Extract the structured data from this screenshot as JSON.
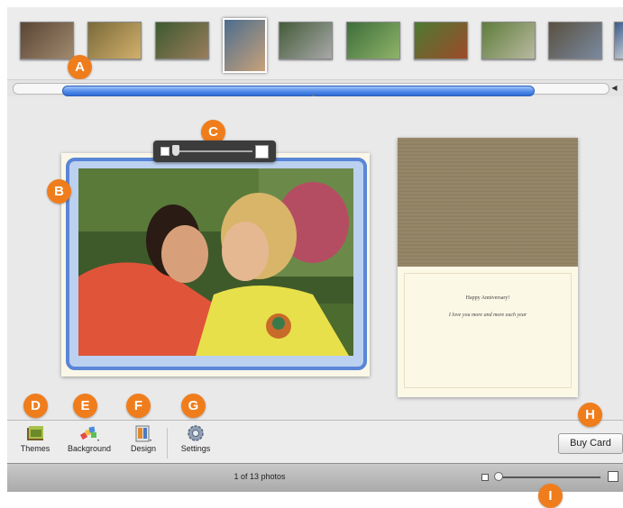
{
  "callouts": {
    "a": "A",
    "b": "B",
    "c": "C",
    "d": "D",
    "e": "E",
    "f": "F",
    "g": "G",
    "h": "H",
    "i": "I"
  },
  "photo_browser": {
    "thumbnails": [
      {
        "colors": [
          "#5a4535",
          "#a0896e"
        ]
      },
      {
        "colors": [
          "#7a6a3a",
          "#d2b06b"
        ]
      },
      {
        "colors": [
          "#3d5a2f",
          "#9a7d5c"
        ]
      },
      {
        "colors": [
          "#4c6d8e",
          "#c8a27a"
        ],
        "selected": true
      },
      {
        "colors": [
          "#445c3a",
          "#a8a8a8"
        ]
      },
      {
        "colors": [
          "#3e6e3a",
          "#8fb36a"
        ]
      },
      {
        "colors": [
          "#4d7a32",
          "#9c4a2a"
        ]
      },
      {
        "colors": [
          "#5f7d3c",
          "#b9b9a0"
        ]
      },
      {
        "colors": [
          "#5a5040",
          "#7a8aa0"
        ]
      },
      {
        "colors": [
          "#3a5a8a",
          "#c0c8d0"
        ]
      }
    ]
  },
  "card": {
    "greeting_title": "Happy Anniversary!",
    "greeting_body": "I love you more and more each year"
  },
  "toolbar": {
    "themes_label": "Themes",
    "background_label": "Background",
    "design_label": "Design",
    "settings_label": "Settings",
    "buy_label": "Buy Card"
  },
  "status": {
    "photo_count": "1 of 13 photos"
  },
  "colors": {
    "accent": "#f07d1c",
    "selection": "#5a86d6",
    "scroll": "#4d87e8"
  }
}
